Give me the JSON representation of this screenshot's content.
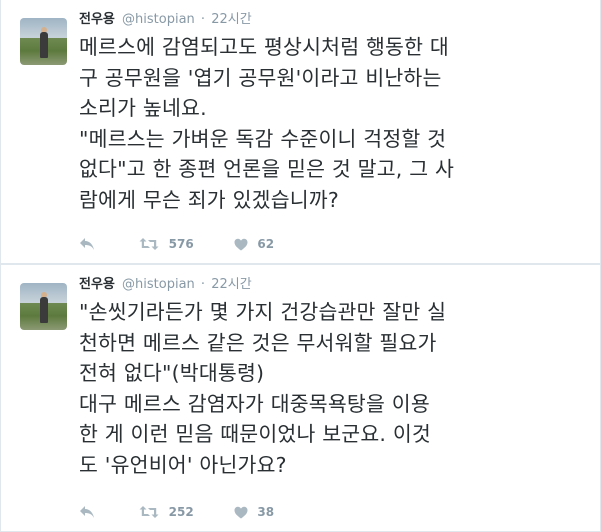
{
  "tweets": [
    {
      "author": {
        "name": "전우용",
        "handle": "@histopian"
      },
      "separator": "·",
      "time": "22시간",
      "lines": [
        "메르스에 감염되고도 평상시처럼 행동한 대",
        "구 공무원을 '엽기 공무원'이라고 비난하는",
        "소리가 높네요.",
        "\"메르스는 가벼운 독감 수준이니 걱정할 것",
        "없다\"고 한 종편 언론을 믿은 것 말고, 그 사",
        "람에게 무슨 죄가 있겠습니까?"
      ],
      "retweets": "576",
      "likes": "62"
    },
    {
      "author": {
        "name": "전우용",
        "handle": "@histopian"
      },
      "separator": "·",
      "time": "22시간",
      "lines": [
        "\"손씻기라든가 몇 가지 건강습관만 잘만 실",
        "천하면 메르스 같은 것은 무서워할 필요가",
        "전혀 없다\"(박대통령)",
        "대구 메르스 감염자가 대중목욕탕을 이용",
        "한 게 이런 믿음 때문이었나 보군요. 이것",
        "도 '유언비어' 아닌가요?"
      ],
      "retweets": "252",
      "likes": "38"
    }
  ],
  "icons": {
    "reply": "reply-arrow-icon",
    "retweet": "retweet-icon",
    "like": "heart-icon"
  },
  "colors": {
    "text": "#292f33",
    "meta": "#8899a6",
    "border": "#e1e8ed",
    "icon": "#aab8c2"
  }
}
